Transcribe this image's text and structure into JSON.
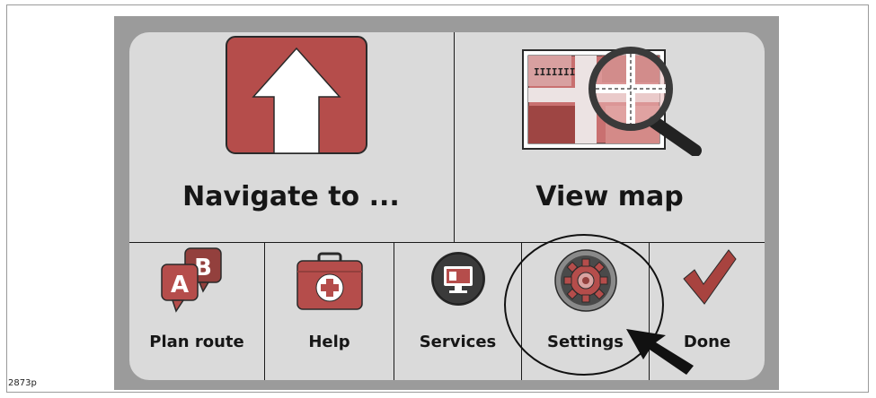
{
  "figure_id": "2873p",
  "main_tiles": [
    {
      "label": "Navigate to ...",
      "icon": "arrow-up-icon"
    },
    {
      "label": "View map",
      "icon": "map-magnifier-icon"
    }
  ],
  "bottom_tiles": [
    {
      "label": "Plan route",
      "icon": "ab-speech-bubbles-icon"
    },
    {
      "label": "Help",
      "icon": "first-aid-kit-icon"
    },
    {
      "label": "Services",
      "icon": "monitor-icon"
    },
    {
      "label": "Settings",
      "icon": "gear-icon"
    },
    {
      "label": "Done",
      "icon": "checkmark-icon"
    }
  ],
  "map_icon_text": "IIIIIII",
  "plan_route_letters": [
    "A",
    "B"
  ],
  "highlight": {
    "target": "Settings",
    "marker": "circle-and-pointer-arrow"
  },
  "colors": {
    "tile_red": "#b54d4b",
    "tile_dark_red": "#93403d",
    "check_red": "#a8433f",
    "screen_bg": "#dadada",
    "bezel": "#9b9b9b",
    "text": "#161616"
  }
}
